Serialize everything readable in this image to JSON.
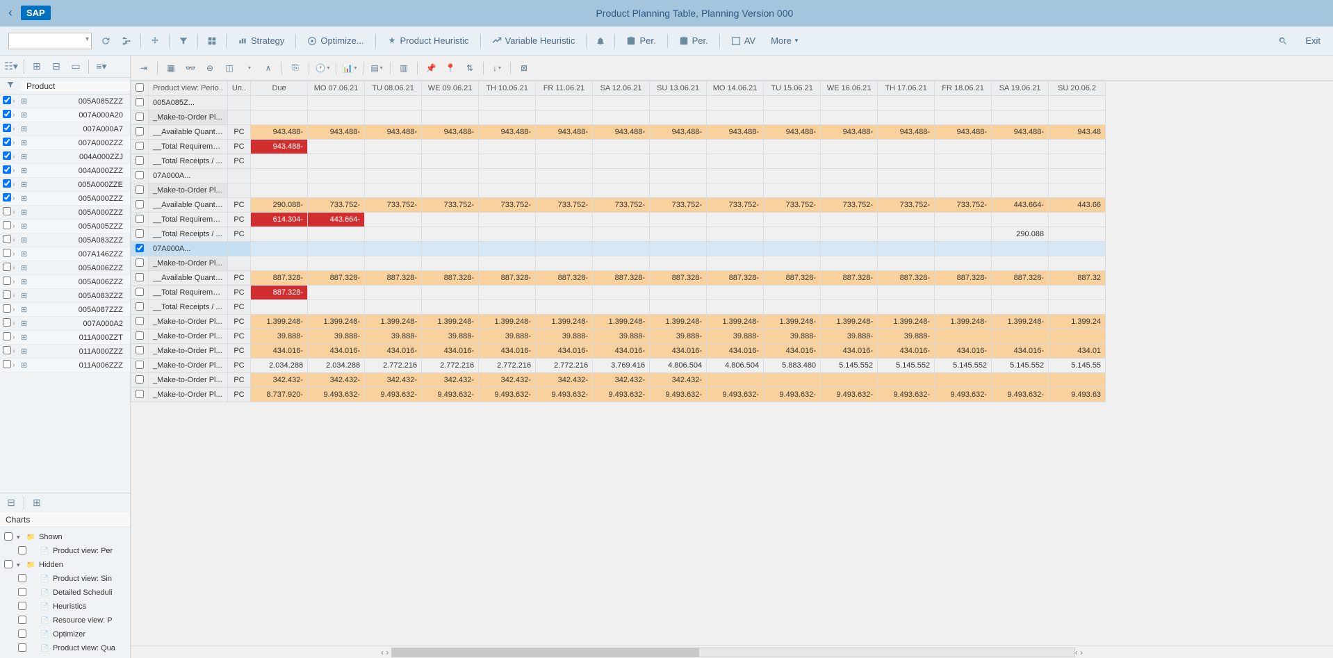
{
  "header": {
    "title": "Product Planning Table, Planning Version 000",
    "exit": "Exit"
  },
  "toolbar": {
    "strategy": "Strategy",
    "optimize": "Optimize...",
    "product_heuristic": "Product Heuristic",
    "variable_heuristic": "Variable Heuristic",
    "per1": "Per.",
    "per2": "Per.",
    "av": "AV",
    "more": "More"
  },
  "sidebar": {
    "product_header": "Product",
    "items": [
      {
        "id": "005A085ZZZ",
        "checked": true
      },
      {
        "id": "007A000A20",
        "checked": true
      },
      {
        "id": "007A000A7",
        "checked": true
      },
      {
        "id": "007A000ZZZ",
        "checked": true
      },
      {
        "id": "004A000ZZJ",
        "checked": true
      },
      {
        "id": "004A000ZZZ",
        "checked": true
      },
      {
        "id": "005A000ZZE",
        "checked": true
      },
      {
        "id": "005A000ZZZ",
        "checked": true
      },
      {
        "id": "005A000ZZZ",
        "checked": false
      },
      {
        "id": "005A005ZZZ",
        "checked": false
      },
      {
        "id": "005A083ZZZ",
        "checked": false
      },
      {
        "id": "007A146ZZZ",
        "checked": false
      },
      {
        "id": "005A006ZZZ",
        "checked": false
      },
      {
        "id": "005A006ZZZ",
        "checked": false
      },
      {
        "id": "005A083ZZZ",
        "checked": false
      },
      {
        "id": "005A087ZZZ",
        "checked": false
      },
      {
        "id": "007A000A2",
        "checked": false
      },
      {
        "id": "011A000ZZT",
        "checked": false
      },
      {
        "id": "011A000ZZZ",
        "checked": false
      },
      {
        "id": "011A006ZZZ",
        "checked": false
      }
    ],
    "charts_header": "Charts",
    "charts": {
      "shown": "Shown",
      "hidden": "Hidden",
      "items": [
        "Product view: Per",
        "Product view: Sin",
        "Detailed Scheduli",
        "Heuristics",
        "Resource view: P",
        "Optimizer",
        "Product view: Qua"
      ]
    }
  },
  "table": {
    "headers": [
      "Product view: Perio..",
      "Un..",
      "Due",
      "MO 07.06.21",
      "TU 08.06.21",
      "WE 09.06.21",
      "TH 10.06.21",
      "FR 11.06.21",
      "SA 12.06.21",
      "SU 13.06.21",
      "MO 14.06.21",
      "TU 15.06.21",
      "WE 16.06.21",
      "TH 17.06.21",
      "FR 18.06.21",
      "SA 19.06.21",
      "SU 20.06.2"
    ],
    "rows": [
      {
        "label": "005A085Z...",
        "unit": "",
        "type": "header",
        "values": [
          "",
          "",
          "",
          "",
          "",
          "",
          "",
          "",
          "",
          "",
          "",
          "",
          "",
          "",
          ""
        ]
      },
      {
        "label": "_Make-to-Order Pl...",
        "unit": "",
        "type": "grey",
        "values": [
          "",
          "",
          "",
          "",
          "",
          "",
          "",
          "",
          "",
          "",
          "",
          "",
          "",
          "",
          ""
        ]
      },
      {
        "label": "__Available Quanti...",
        "unit": "PC",
        "type": "orange",
        "values": [
          "943.488-",
          "943.488-",
          "943.488-",
          "943.488-",
          "943.488-",
          "943.488-",
          "943.488-",
          "943.488-",
          "943.488-",
          "943.488-",
          "943.488-",
          "943.488-",
          "943.488-",
          "943.488-",
          "943.48"
        ]
      },
      {
        "label": "__Total Requireme...",
        "unit": "PC",
        "type": "normal",
        "values": [
          "943.488-",
          "",
          "",
          "",
          "",
          "",
          "",
          "",
          "",
          "",
          "",
          "",
          "",
          "",
          ""
        ],
        "red": [
          0
        ]
      },
      {
        "label": "__Total Receipts / ...",
        "unit": "PC",
        "type": "normal",
        "values": [
          "",
          "",
          "",
          "",
          "",
          "",
          "",
          "",
          "",
          "",
          "",
          "",
          "",
          "",
          ""
        ]
      },
      {
        "label": "07A000A...",
        "unit": "",
        "type": "header",
        "values": [
          "",
          "",
          "",
          "",
          "",
          "",
          "",
          "",
          "",
          "",
          "",
          "",
          "",
          "",
          ""
        ]
      },
      {
        "label": "_Make-to-Order Pl...",
        "unit": "",
        "type": "grey",
        "values": [
          "",
          "",
          "",
          "",
          "",
          "",
          "",
          "",
          "",
          "",
          "",
          "",
          "",
          "",
          ""
        ]
      },
      {
        "label": "__Available Quanti...",
        "unit": "PC",
        "type": "orange",
        "values": [
          "290.088-",
          "733.752-",
          "733.752-",
          "733.752-",
          "733.752-",
          "733.752-",
          "733.752-",
          "733.752-",
          "733.752-",
          "733.752-",
          "733.752-",
          "733.752-",
          "733.752-",
          "443.664-",
          "443.66"
        ]
      },
      {
        "label": "__Total Requireme...",
        "unit": "PC",
        "type": "normal",
        "values": [
          "614.304-",
          "443.664-",
          "",
          "",
          "",
          "",
          "",
          "",
          "",
          "",
          "",
          "",
          "",
          "",
          ""
        ],
        "red": [
          0,
          1
        ]
      },
      {
        "label": "__Total Receipts / ...",
        "unit": "PC",
        "type": "normal",
        "values": [
          "",
          "",
          "",
          "",
          "",
          "",
          "",
          "",
          "",
          "",
          "",
          "",
          "",
          "290.088",
          ""
        ]
      },
      {
        "label": "07A000A...",
        "unit": "",
        "type": "selected",
        "checked": true,
        "values": [
          "",
          "",
          "",
          "",
          "",
          "",
          "",
          "",
          "",
          "",
          "",
          "",
          "",
          "",
          ""
        ]
      },
      {
        "label": "_Make-to-Order Pl...",
        "unit": "",
        "type": "grey",
        "values": [
          "",
          "",
          "",
          "",
          "",
          "",
          "",
          "",
          "",
          "",
          "",
          "",
          "",
          "",
          ""
        ]
      },
      {
        "label": "__Available Quanti...",
        "unit": "PC",
        "type": "orange",
        "values": [
          "887.328-",
          "887.328-",
          "887.328-",
          "887.328-",
          "887.328-",
          "887.328-",
          "887.328-",
          "887.328-",
          "887.328-",
          "887.328-",
          "887.328-",
          "887.328-",
          "887.328-",
          "887.328-",
          "887.32"
        ]
      },
      {
        "label": "__Total Requireme...",
        "unit": "PC",
        "type": "normal",
        "values": [
          "887.328-",
          "",
          "",
          "",
          "",
          "",
          "",
          "",
          "",
          "",
          "",
          "",
          "",
          "",
          ""
        ],
        "red": [
          0
        ]
      },
      {
        "label": "__Total Receipts / ...",
        "unit": "PC",
        "type": "normal",
        "values": [
          "",
          "",
          "",
          "",
          "",
          "",
          "",
          "",
          "",
          "",
          "",
          "",
          "",
          "",
          ""
        ]
      },
      {
        "label": "_Make-to-Order Pl...",
        "unit": "PC",
        "type": "orange",
        "values": [
          "1.399.248-",
          "1.399.248-",
          "1.399.248-",
          "1.399.248-",
          "1.399.248-",
          "1.399.248-",
          "1.399.248-",
          "1.399.248-",
          "1.399.248-",
          "1.399.248-",
          "1.399.248-",
          "1.399.248-",
          "1.399.248-",
          "1.399.248-",
          "1.399.24"
        ]
      },
      {
        "label": "_Make-to-Order Pl...",
        "unit": "PC",
        "type": "orange",
        "values": [
          "39.888-",
          "39.888-",
          "39.888-",
          "39.888-",
          "39.888-",
          "39.888-",
          "39.888-",
          "39.888-",
          "39.888-",
          "39.888-",
          "39.888-",
          "39.888-",
          "",
          "",
          ""
        ]
      },
      {
        "label": "_Make-to-Order Pl...",
        "unit": "PC",
        "type": "orange",
        "values": [
          "434.016-",
          "434.016-",
          "434.016-",
          "434.016-",
          "434.016-",
          "434.016-",
          "434.016-",
          "434.016-",
          "434.016-",
          "434.016-",
          "434.016-",
          "434.016-",
          "434.016-",
          "434.016-",
          "434.01"
        ]
      },
      {
        "label": "_Make-to-Order Pl...",
        "unit": "PC",
        "type": "normal",
        "values": [
          "2.034.288",
          "2.034.288",
          "2.772.216",
          "2.772.216",
          "2.772.216",
          "2.772.216",
          "3.769.416",
          "4.806.504",
          "4.806.504",
          "5.883.480",
          "5.145.552",
          "5.145.552",
          "5.145.552",
          "5.145.552",
          "5.145.55"
        ]
      },
      {
        "label": "_Make-to-Order Pl...",
        "unit": "PC",
        "type": "orange",
        "values": [
          "342.432-",
          "342.432-",
          "342.432-",
          "342.432-",
          "342.432-",
          "342.432-",
          "342.432-",
          "342.432-",
          "",
          "",
          "",
          "",
          "",
          "",
          ""
        ]
      },
      {
        "label": "_Make-to-Order Pl...",
        "unit": "PC",
        "type": "orange",
        "values": [
          "8.737.920-",
          "9.493.632-",
          "9.493.632-",
          "9.493.632-",
          "9.493.632-",
          "9.493.632-",
          "9.493.632-",
          "9.493.632-",
          "9.493.632-",
          "9.493.632-",
          "9.493.632-",
          "9.493.632-",
          "9.493.632-",
          "9.493.632-",
          "9.493.63"
        ]
      }
    ]
  }
}
